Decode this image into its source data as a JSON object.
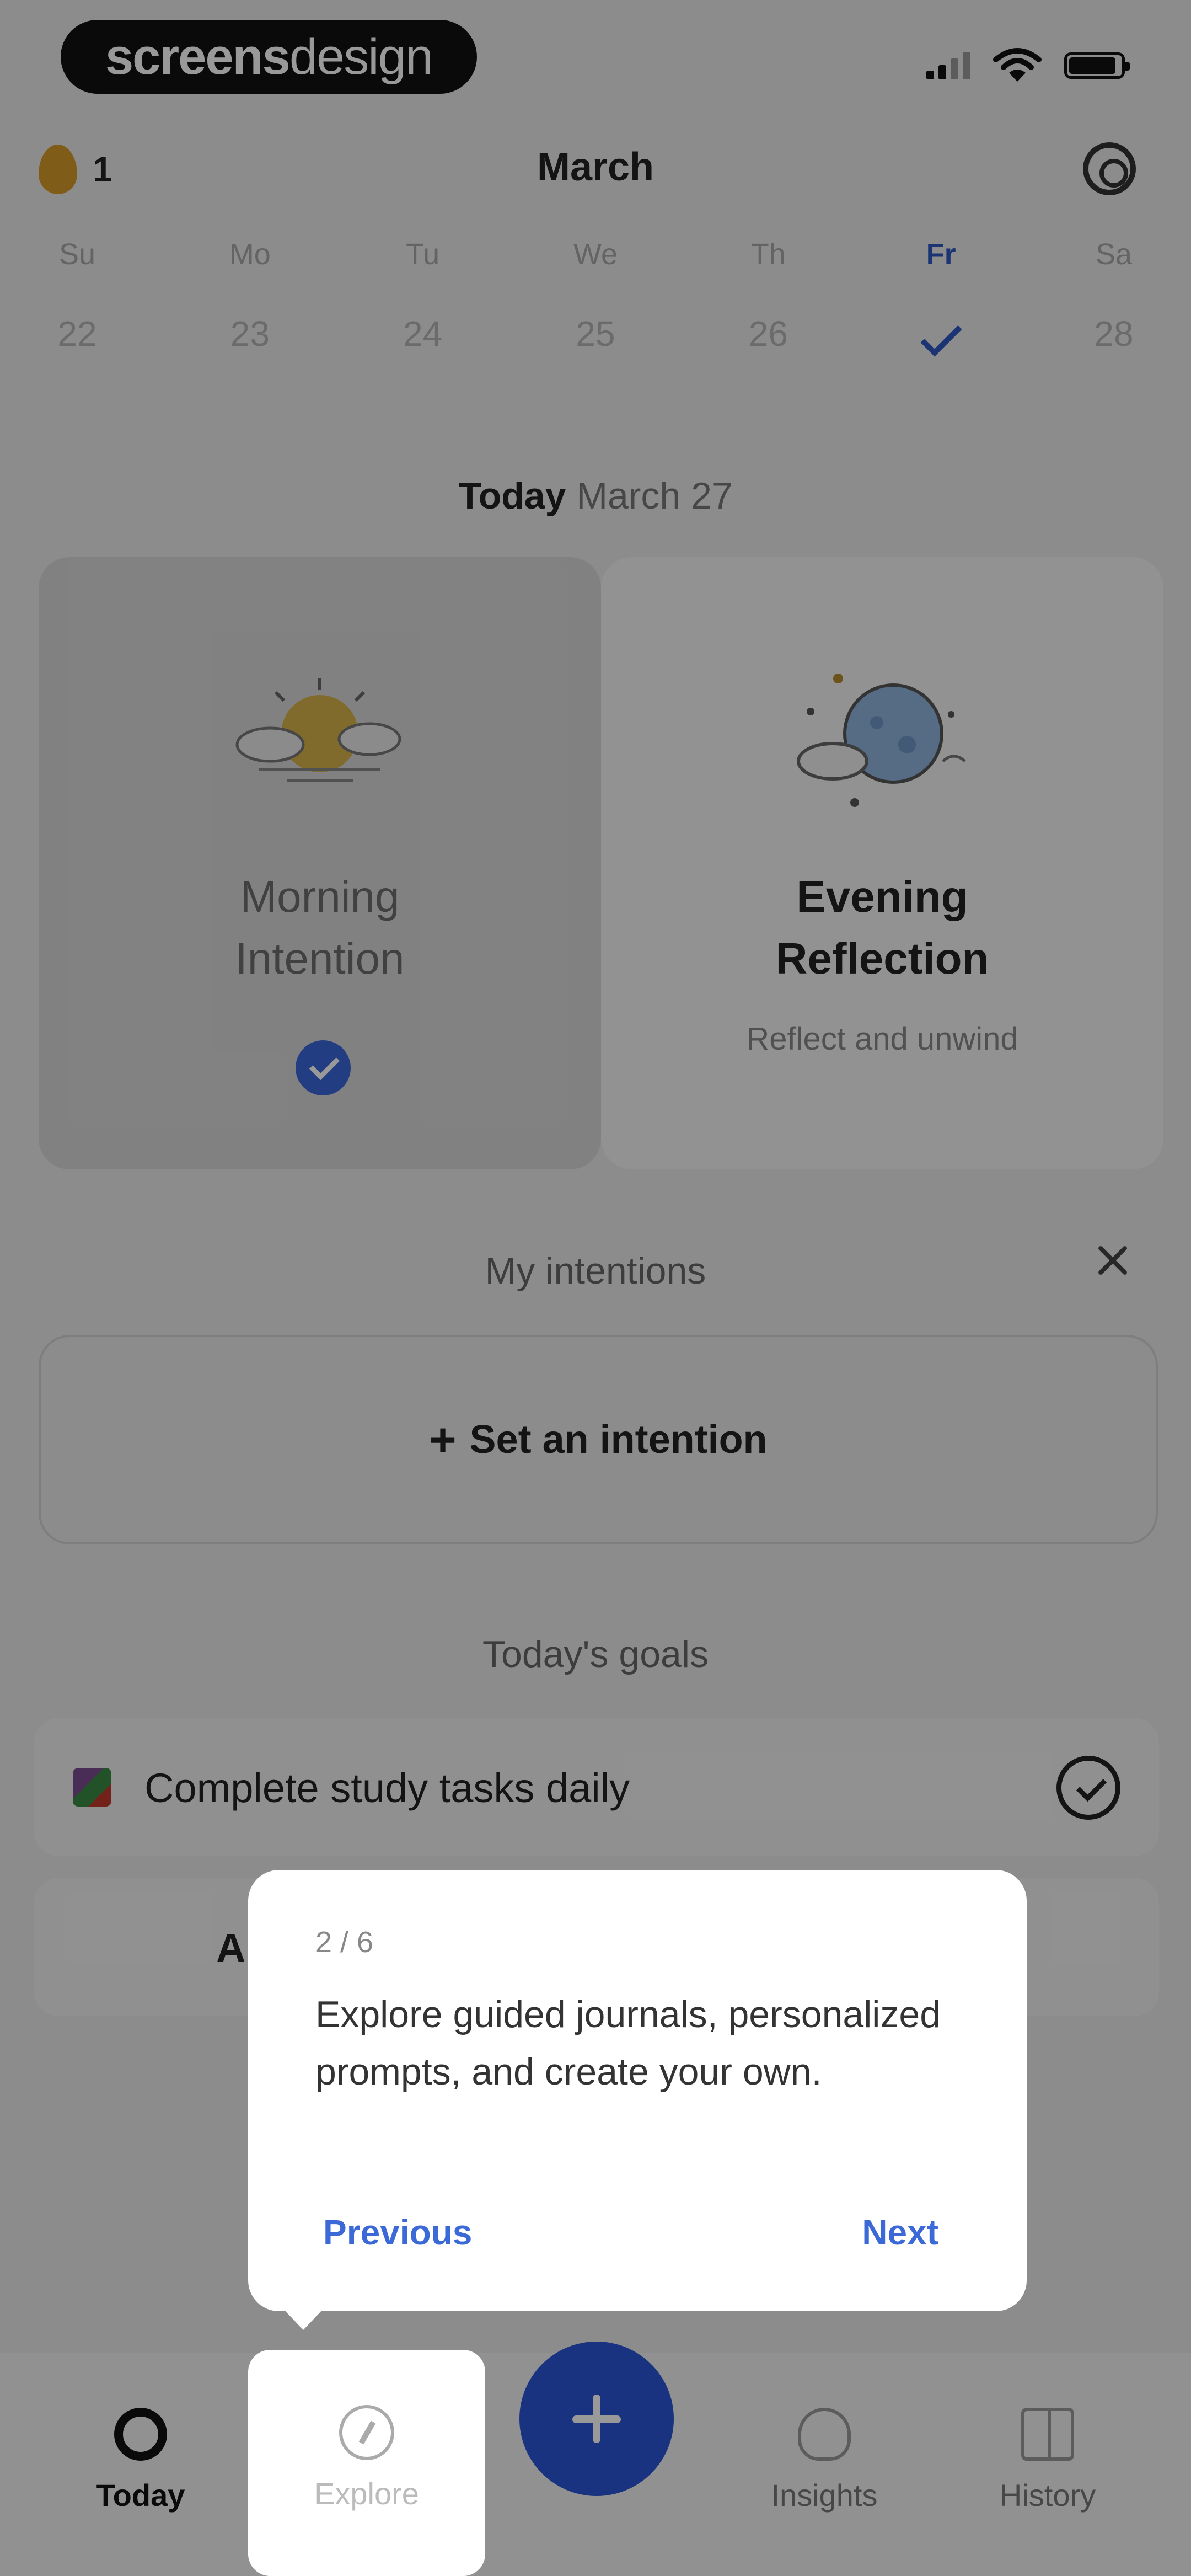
{
  "watermark": {
    "bold": "screens",
    "light": "design"
  },
  "header": {
    "streak_count": "1",
    "month": "March"
  },
  "week": [
    {
      "name": "Su",
      "date": "22"
    },
    {
      "name": "Mo",
      "date": "23"
    },
    {
      "name": "Tu",
      "date": "24"
    },
    {
      "name": "We",
      "date": "25"
    },
    {
      "name": "Th",
      "date": "26"
    },
    {
      "name": "Fr",
      "date": ""
    },
    {
      "name": "Sa",
      "date": "28"
    }
  ],
  "today": {
    "label": "Today",
    "date": "March 27"
  },
  "cards": {
    "morning": {
      "title_line1": "Morning",
      "title_line2": "Intention"
    },
    "evening": {
      "title_line1": "Evening",
      "title_line2": "Reflection",
      "subtitle": "Reflect and unwind"
    }
  },
  "intentions": {
    "title": "My intentions",
    "add_label": "Set an intention"
  },
  "goals": {
    "title": "Today's goals",
    "items": [
      {
        "text": "Complete study tasks daily"
      },
      {
        "text": "A"
      }
    ]
  },
  "tooltip": {
    "step": "2 / 6",
    "body": "Explore guided journals, personalized prompts, and create your own.",
    "previous": "Previous",
    "next": "Next"
  },
  "tabs": {
    "today": "Today",
    "explore": "Explore",
    "insights": "Insights",
    "history": "History"
  },
  "colors": {
    "accent": "#2c56d6",
    "flame": "#d59a2a"
  }
}
